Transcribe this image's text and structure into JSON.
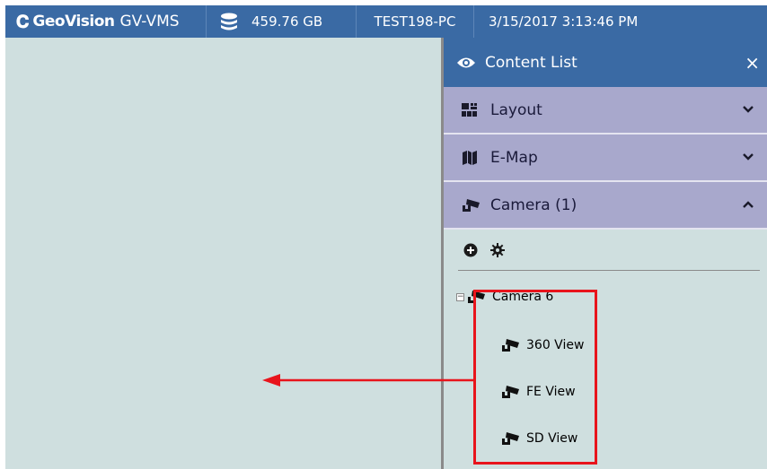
{
  "topbar": {
    "brand": "GeoVision",
    "product": "GV-VMS",
    "storage": "459.76 GB",
    "pc_name": "TEST198-PC",
    "datetime": "3/15/2017 3:13:46 PM"
  },
  "panel": {
    "title": "Content List",
    "close": "×",
    "sections": [
      {
        "label": "Layout",
        "icon": "layout-grid-icon",
        "state": "collapsed"
      },
      {
        "label": "E-Map",
        "icon": "map-icon",
        "state": "collapsed"
      },
      {
        "label": "Camera (1)",
        "icon": "camera-icon",
        "state": "expanded"
      }
    ],
    "tree": {
      "root": "Camera 6",
      "children": [
        "360 View",
        "FE View",
        "SD View"
      ]
    }
  },
  "colors": {
    "topbar_bg": "#3a6aa4",
    "section_bg": "#a8a8cc",
    "workspace_bg": "#cfdfdf",
    "highlight": "#e8141c"
  }
}
